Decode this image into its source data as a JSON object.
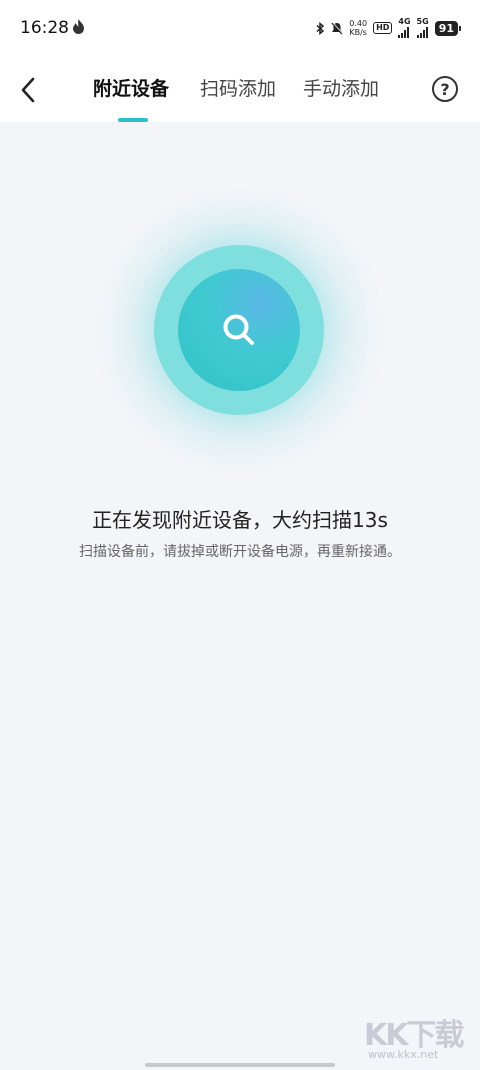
{
  "status_bar": {
    "time": "16:28",
    "net_speed_value": "0.40",
    "net_speed_unit": "KB/s",
    "hd_label": "HD",
    "signal1_label": "4G",
    "signal2_label": "5G",
    "battery": "91",
    "icons": [
      "flame-icon",
      "bluetooth-icon",
      "mute-icon"
    ]
  },
  "nav": {
    "back_icon": "chevron-left-icon",
    "tabs": [
      {
        "label": "附近设备",
        "active": true
      },
      {
        "label": "扫码添加",
        "active": false
      },
      {
        "label": "手动添加",
        "active": false
      }
    ],
    "help_icon": "question-circle-icon",
    "help_label": "?"
  },
  "scan": {
    "icon": "search-icon",
    "title": "正在发现附近设备，大约扫描13s",
    "hint": "扫描设备前，请拔掉或断开设备电源，再重新接通。"
  },
  "watermark": {
    "logo": "KK下载",
    "url": "www.kkx.net"
  },
  "colors": {
    "accent": "#2cc1c6",
    "background": "#f4f5f8",
    "ring": "#7fdede"
  }
}
